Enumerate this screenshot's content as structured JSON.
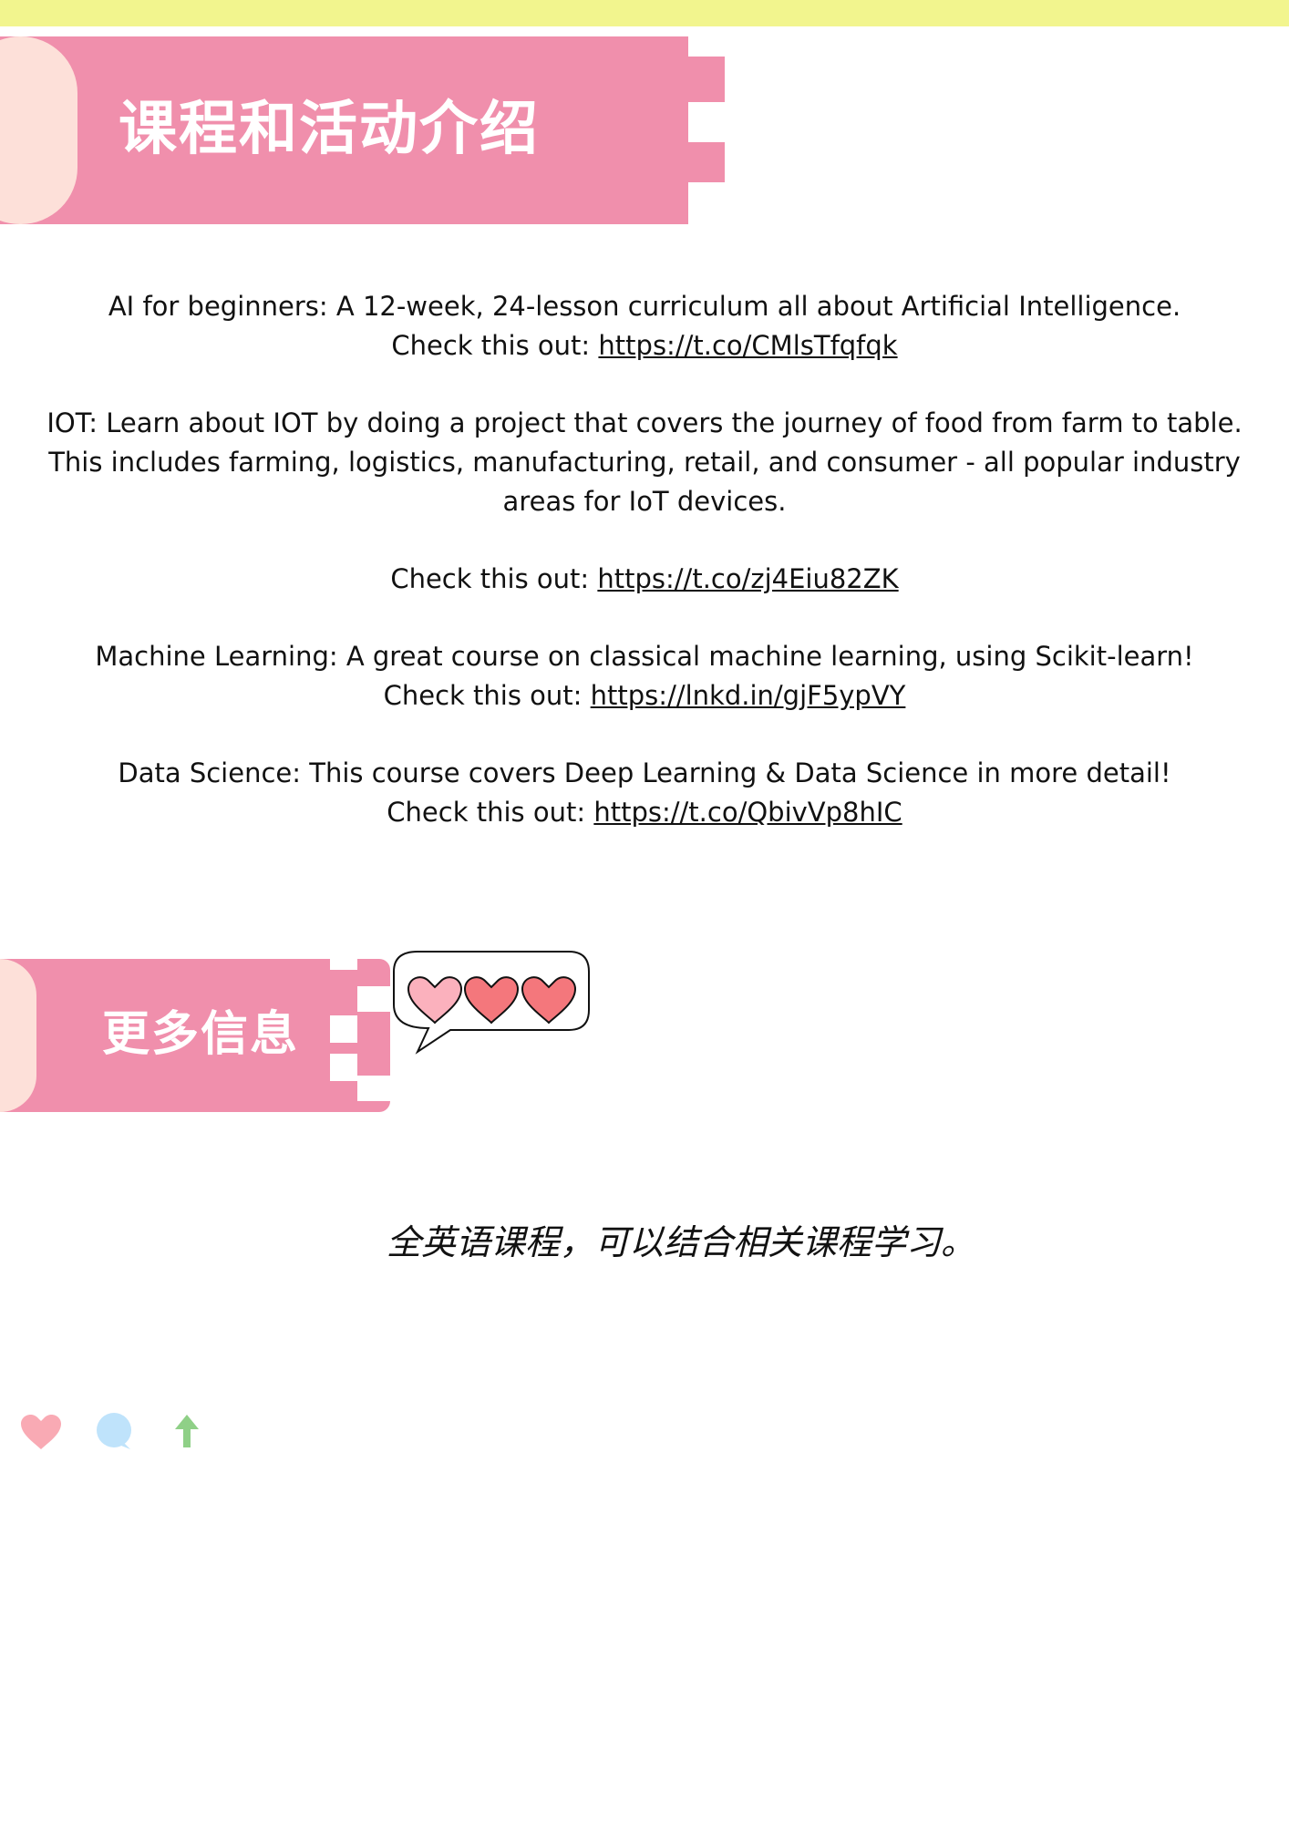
{
  "header": {
    "section_title": "课程和活动介绍"
  },
  "courses": [
    {
      "description": "AI for beginners: A 12-week, 24-lesson curriculum all about Artificial Intelligence.",
      "cta_prefix": "Check this out: ",
      "link_text": "https://t.co/CMlsTfqfqk"
    },
    {
      "description": "IOT: Learn about IOT by doing a project that covers the journey of food from farm to table. This includes farming, logistics, manufacturing, retail, and consumer - all popular industry areas for IoT devices.",
      "cta_prefix": "Check this out: ",
      "link_text": "https://t.co/zj4Eiu82ZK"
    },
    {
      "description": "Machine Learning: A great course on classical machine learning, using Scikit-learn!",
      "cta_prefix": "Check this out: ",
      "link_text": "https://lnkd.in/gjF5ypVY"
    },
    {
      "description": "Data Science: This course covers Deep Learning & Data Science in more detail!",
      "cta_prefix": "Check this out: ",
      "link_text": "https://t.co/QbivVp8hIC"
    }
  ],
  "more_info": {
    "section_title": "更多信息",
    "note": "全英语课程，可以结合相关课程学习。"
  },
  "colors": {
    "top_strip": "#f2f58e",
    "banner_pink": "#f08fac",
    "banner_cap": "#fde0d9",
    "heart_light": "#fbb1bd",
    "heart_dark": "#f4777c",
    "action_heart": "#f9aab4",
    "action_comment": "#bfe3fb",
    "action_share": "#8fd087"
  },
  "icons": [
    "heart-icon",
    "comment-icon",
    "share-arrow-icon"
  ]
}
